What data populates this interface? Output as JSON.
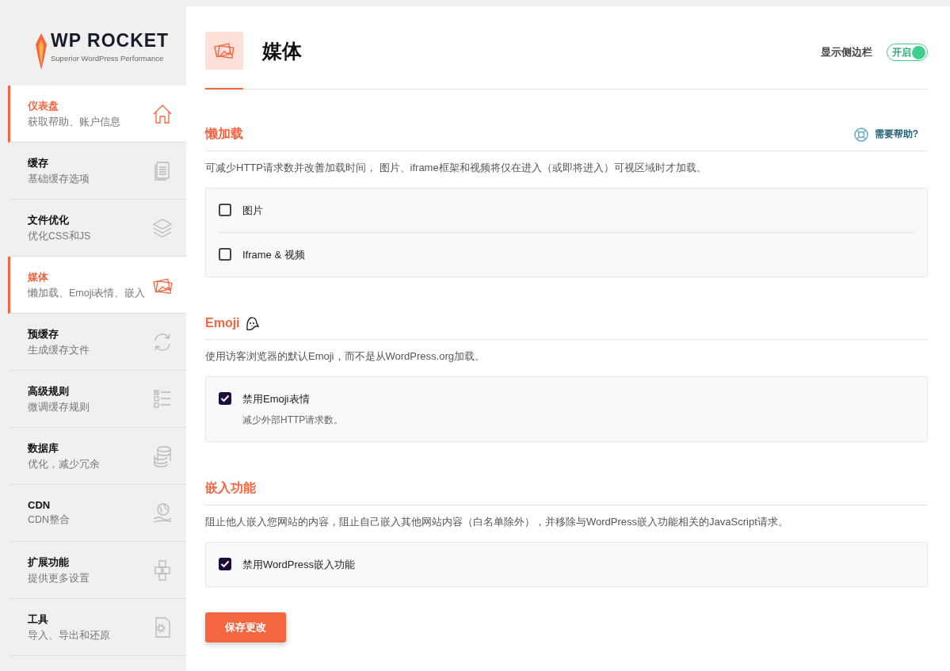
{
  "logo": {
    "name": "WP ROCKET",
    "tagline": "Superior WordPress Performance"
  },
  "sidebar": {
    "items": [
      {
        "title": "仪表盘",
        "subtitle": "获取帮助、账户信息",
        "kind": "home",
        "selected": true
      },
      {
        "title": "缓存",
        "subtitle": "基础缓存选项",
        "kind": "document",
        "selected": false
      },
      {
        "title": "文件优化",
        "subtitle": "优化CSS和JS",
        "kind": "layers",
        "selected": false
      },
      {
        "title": "媒体",
        "subtitle": "懒加载、Emoji表情、嵌入",
        "kind": "photos",
        "selected": true
      },
      {
        "title": "预缓存",
        "subtitle": "生成缓存文件",
        "kind": "refresh",
        "selected": false
      },
      {
        "title": "高级规则",
        "subtitle": "微调缓存规则",
        "kind": "checklist",
        "selected": false
      },
      {
        "title": "数据库",
        "subtitle": "优化，减少冗余",
        "kind": "database",
        "selected": false
      },
      {
        "title": "CDN",
        "subtitle": "CDN整合",
        "kind": "globe",
        "selected": false
      },
      {
        "title": "扩展功能",
        "subtitle": "提供更多设置",
        "kind": "cubes",
        "selected": false
      },
      {
        "title": "工具",
        "subtitle": "导入、导出和还原",
        "kind": "file-gear",
        "selected": false
      }
    ]
  },
  "header": {
    "title": "媒体",
    "sidebar_toggle": {
      "label": "显示侧边栏",
      "state": "开启",
      "on": true
    }
  },
  "sections": [
    {
      "title": "懒加载",
      "help": "需要帮助?",
      "description": "可减少HTTP请求数并改善加载时间， 图片、iframe框架和视频将仅在进入（或即将进入）可视区域时才加载。",
      "options": [
        {
          "label": "图片",
          "checked": false
        },
        {
          "label": "Iframe & 视频",
          "checked": false
        }
      ]
    },
    {
      "title": "Emoji",
      "emoji_icon": true,
      "description": "使用访客浏览器的默认Emoji，而不是从WordPress.org加载。",
      "options": [
        {
          "label": "禁用Emoji表情",
          "hint": "减少外部HTTP请求数。",
          "checked": true
        }
      ]
    },
    {
      "title": "嵌入功能",
      "description": "阻止他人嵌入您网站的内容，阻止自己嵌入其他网站内容（白名单除外），并移除与WordPress嵌入功能相关的JavaScript请求。",
      "options": [
        {
          "label": "禁用WordPress嵌入功能",
          "checked": true
        }
      ]
    }
  ],
  "save_button": "保存更改"
}
